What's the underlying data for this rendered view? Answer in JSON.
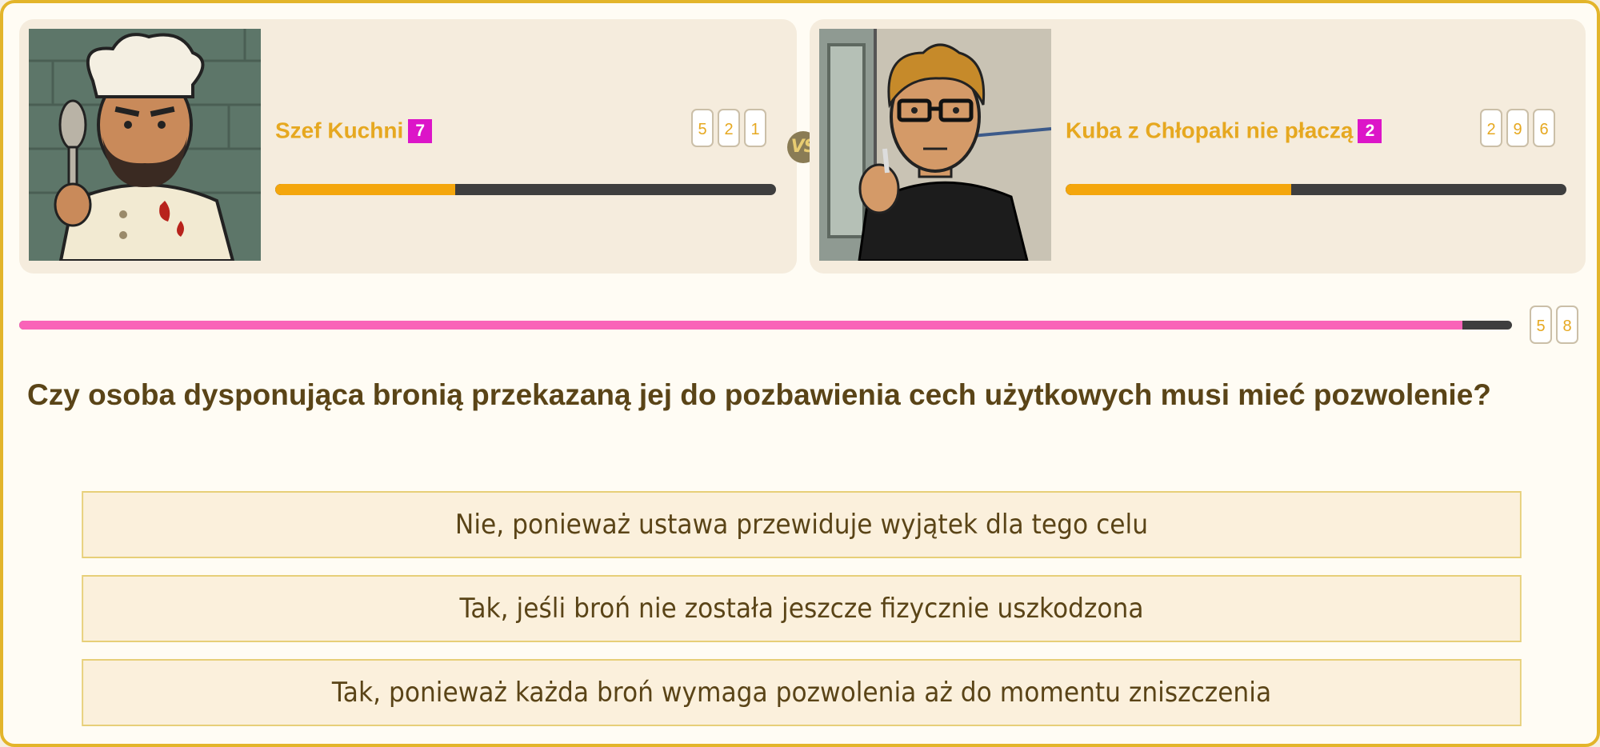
{
  "players": [
    {
      "name": "Szef Kuchni",
      "level": "7",
      "score_digits": [
        "5",
        "2",
        "1"
      ],
      "hp_fraction": 0.36,
      "avatar": "chef-with-spoon"
    },
    {
      "name": "Kuba z Chłopaki nie płaczą",
      "level": "2",
      "score_digits": [
        "2",
        "9",
        "6"
      ],
      "hp_fraction": 0.45,
      "avatar": "man-with-glasses"
    }
  ],
  "vs_label": "VS",
  "timer": {
    "fraction_remaining": 0.967,
    "digits": [
      "5",
      "8"
    ]
  },
  "question": "Czy osoba dysponująca bronią przekazaną jej do pozbawienia cech użytkowych musi mieć pozwolenie?",
  "answers": [
    "Nie, ponieważ ustawa przewiduje wyjątek dla tego celu",
    "Tak, jeśli broń nie została jeszcze fizycznie uszkodzona",
    "Tak, ponieważ każda broń wymaga pozwolenia aż do momentu zniszczenia"
  ],
  "colors": {
    "accent": "#e3b52a",
    "name": "#e6a820",
    "level_badge": "#dc15c8",
    "hp_fill": "#f4a60c",
    "timer_fill": "#f963b8",
    "question_text": "#5a4417"
  }
}
